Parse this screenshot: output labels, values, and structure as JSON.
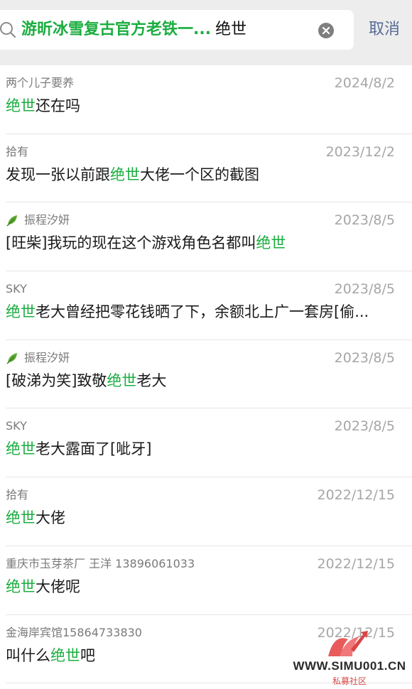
{
  "search": {
    "scope": "游昕冰雪复古官方老铁一...",
    "term": "绝世",
    "cancel_label": "取消"
  },
  "colors": {
    "highlight": "#1aad3f",
    "link_blue": "#576b95",
    "header_bg": "#ededed"
  },
  "results": [
    {
      "sender": "两个儿子要养",
      "has_leaf": false,
      "date": "2024/8/2",
      "message": [
        {
          "t": "绝世",
          "hl": true
        },
        {
          "t": "还在吗",
          "hl": false
        }
      ]
    },
    {
      "sender": "拾有",
      "has_leaf": false,
      "date": "2023/12/2",
      "message": [
        {
          "t": "发现一张以前跟",
          "hl": false
        },
        {
          "t": "绝世",
          "hl": true
        },
        {
          "t": "大佬一个区的截图",
          "hl": false
        }
      ]
    },
    {
      "sender": "振程汐妍",
      "has_leaf": true,
      "date": "2023/8/5",
      "message": [
        {
          "t": "[旺柴]我玩的现在这个游戏角色名都叫",
          "hl": false
        },
        {
          "t": "绝世",
          "hl": true
        }
      ]
    },
    {
      "sender": "SKY",
      "has_leaf": false,
      "date": "2023/8/5",
      "message": [
        {
          "t": "绝世",
          "hl": true
        },
        {
          "t": "老大曾经把零花钱晒了下，余额北上广一套房[偷...",
          "hl": false
        }
      ]
    },
    {
      "sender": "振程汐妍",
      "has_leaf": true,
      "date": "2023/8/5",
      "message": [
        {
          "t": "[破涕为笑]致敬",
          "hl": false
        },
        {
          "t": "绝世",
          "hl": true
        },
        {
          "t": "老大",
          "hl": false
        }
      ]
    },
    {
      "sender": "SKY",
      "has_leaf": false,
      "date": "2023/8/5",
      "message": [
        {
          "t": "绝世",
          "hl": true
        },
        {
          "t": "老大露面了[呲牙]",
          "hl": false
        }
      ]
    },
    {
      "sender": "拾有",
      "has_leaf": false,
      "date": "2022/12/15",
      "message": [
        {
          "t": "绝世",
          "hl": true
        },
        {
          "t": "大佬",
          "hl": false
        }
      ]
    },
    {
      "sender": "重庆市玉芽茶厂 王洋 13896061033",
      "has_leaf": false,
      "date": "2022/12/15",
      "message": [
        {
          "t": "绝世",
          "hl": true
        },
        {
          "t": "大佬呢",
          "hl": false
        }
      ]
    },
    {
      "sender": "金海岸宾馆15864733830",
      "has_leaf": false,
      "date": "2022/12/15",
      "message": [
        {
          "t": "叫什么",
          "hl": false
        },
        {
          "t": "绝世",
          "hl": true
        },
        {
          "t": "吧",
          "hl": false
        }
      ]
    }
  ],
  "watermark": {
    "site": "WWW.SIMU001.CN",
    "name": "私募社区"
  }
}
